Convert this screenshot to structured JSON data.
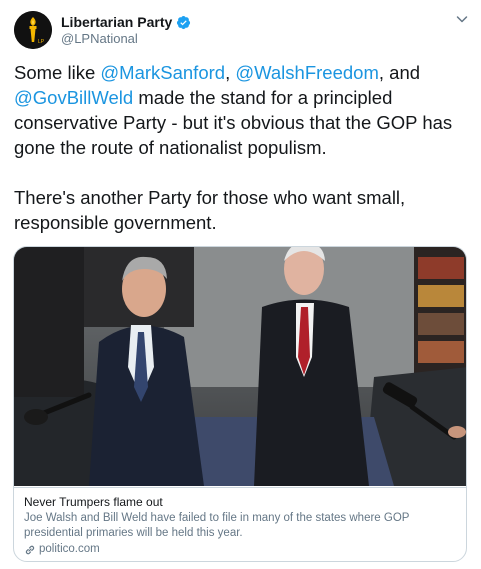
{
  "account": {
    "name": "Libertarian Party",
    "handle": "@LPNational",
    "verified": true,
    "avatar_icon": "torch-logo"
  },
  "tweet": {
    "segments": [
      {
        "text": "Some like ",
        "type": "text"
      },
      {
        "text": "@MarkSanford",
        "type": "mention"
      },
      {
        "text": ", ",
        "type": "text"
      },
      {
        "text": "@WalshFreedom",
        "type": "mention"
      },
      {
        "text": ", and ",
        "type": "text"
      },
      {
        "text": "@GovBillWeld",
        "type": "mention"
      },
      {
        "text": " made the stand for a principled conservative Party - but it's obvious that the GOP has gone the route of nationalist populism.\n\nThere's another Party for those who want small, responsible government.",
        "type": "text"
      }
    ]
  },
  "card": {
    "title": "Never Trumpers flame out",
    "description": "Joe Walsh and Bill Weld have failed to file in many of the states where GOP presidential primaries will be held this year.",
    "domain": "politico.com",
    "image_alt": "photo-two-men-in-suits"
  },
  "colors": {
    "mention": "#1b95e0",
    "verified": "#1da1f2",
    "muted": "#657786"
  }
}
